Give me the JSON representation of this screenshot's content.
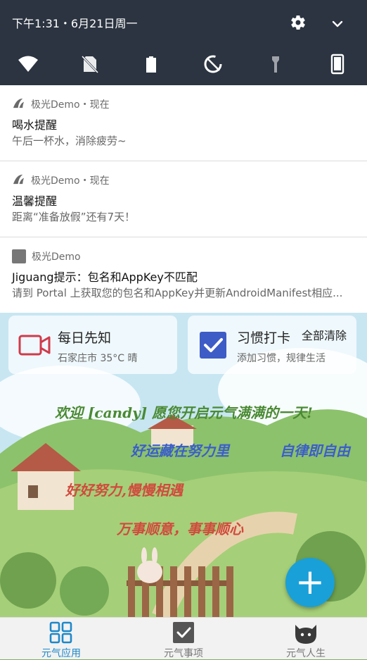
{
  "status_bar": {
    "datetime": "下午1:31・6月21日周一"
  },
  "quick_settings": {
    "icons": [
      "wifi-icon",
      "no-sim-icon",
      "battery-icon",
      "data-saver-icon",
      "flashlight-icon",
      "phone-icon"
    ]
  },
  "notifications": [
    {
      "app": "极光Demo",
      "time_label": "・现在",
      "title": "喝水提醒",
      "body": "午后一杯水，消除疲劳~"
    },
    {
      "app": "极光Demo",
      "time_label": "・现在",
      "title": "温馨提醒",
      "body": "距离“准备放假”还有7天！"
    },
    {
      "app": "极光Demo",
      "time_label": "",
      "title": "Jiguang提示：包名和AppKey不匹配",
      "body": "请到 Portal 上获取您的包名和AppKey并更新AndroidManifest相应..."
    }
  ],
  "cards": {
    "daily": {
      "title": "每日先知",
      "subtitle": "石家庄市  35°C  晴"
    },
    "habit": {
      "title": "习惯打卡",
      "subtitle": "添加习惯，规律生活"
    }
  },
  "clear_all": "全部清除",
  "slogans": [
    "欢迎 [candy] 愿您开启元气满满的一天!",
    "好运藏在努力里",
    "自律即自由",
    "好好努力,慢慢相遇",
    "万事顺意，事事顺心"
  ],
  "fab_label": "+",
  "bottom_nav": [
    {
      "label": "元气应用",
      "icon": "apps-grid-icon",
      "active": true
    },
    {
      "label": "元气事项",
      "icon": "checkbox-icon",
      "active": false
    },
    {
      "label": "元气人生",
      "icon": "cat-face-icon",
      "active": false
    }
  ],
  "colors": {
    "shade_bg": "#2b3440",
    "accent": "#1e88c8",
    "fab": "#1aa0d8",
    "video_icon": "#d03a4a",
    "check_icon": "#3d5cc6"
  }
}
